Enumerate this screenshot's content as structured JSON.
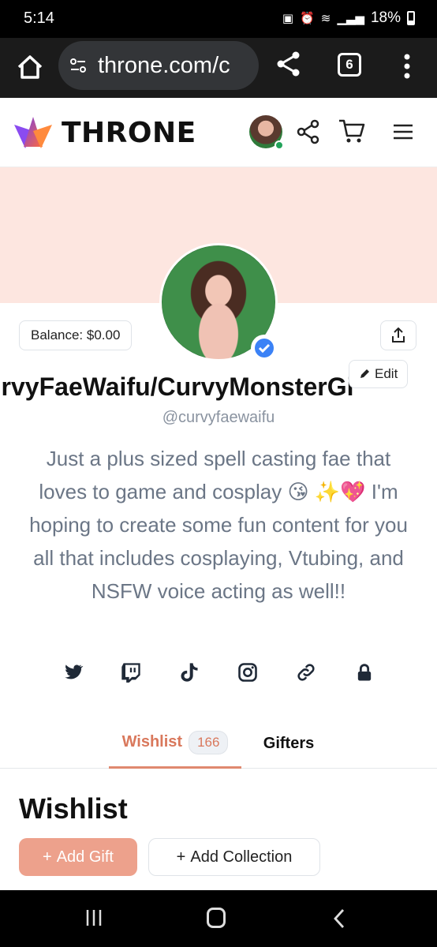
{
  "status": {
    "time": "5:14",
    "battery": "18%"
  },
  "browser": {
    "url": "throne.com/c",
    "tab_count": "6"
  },
  "site": {
    "brand": "THRONE"
  },
  "profile": {
    "balance": "Balance: $0.00",
    "edit_label": "Edit",
    "display_name": "urvyFaeWaifu/CurvyMonsterGi",
    "handle": "@curvyfaewaifu",
    "bio": "Just a plus sized spell casting fae that loves to game and cosplay 😘 ✨💖 I'm hoping to create some fun content for you all that includes cosplaying, Vtubing, and NSFW voice acting as well!!",
    "socials": [
      "twitter-icon",
      "twitch-icon",
      "tiktok-icon",
      "instagram-icon",
      "link-icon",
      "lock-icon"
    ]
  },
  "tabs": {
    "wishlist": "Wishlist",
    "wishlist_count": "166",
    "gifters": "Gifters"
  },
  "wishlist": {
    "title": "Wishlist",
    "add_gift": "Add Gift",
    "add_collection": "Add Collection"
  },
  "colors": {
    "accent": "#d9785c",
    "cover": "#fde6e0",
    "button": "#eda18c"
  }
}
